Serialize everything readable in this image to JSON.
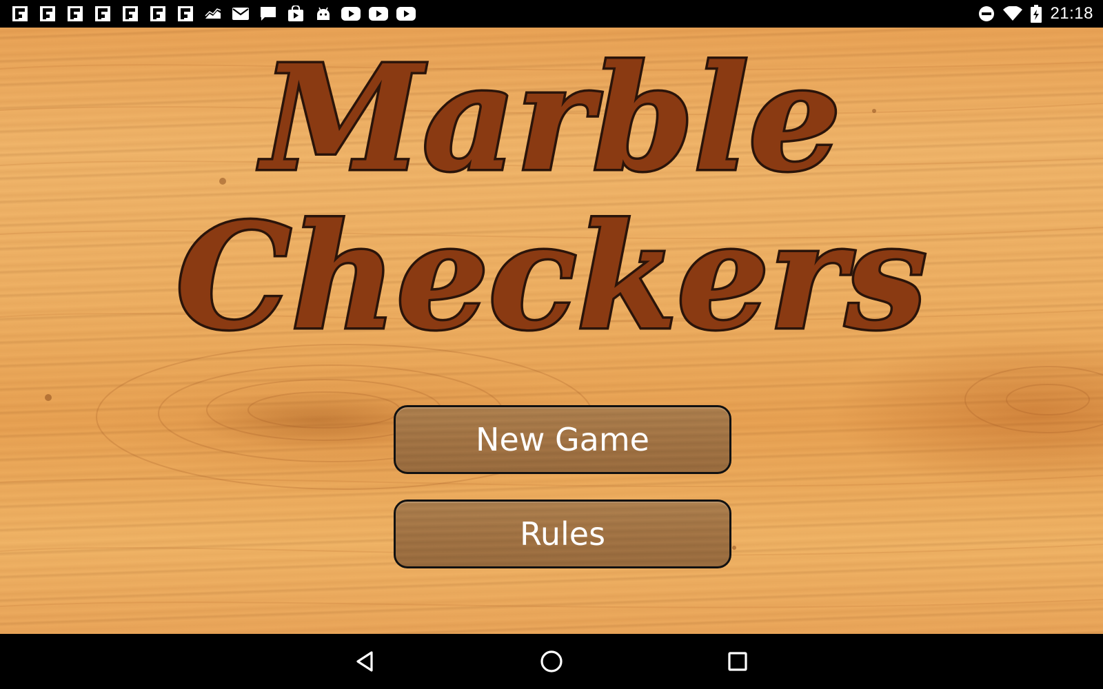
{
  "status_bar": {
    "time": "21:18",
    "notifications": [
      {
        "icon": "flipboard-icon"
      },
      {
        "icon": "flipboard-icon"
      },
      {
        "icon": "flipboard-icon"
      },
      {
        "icon": "flipboard-icon"
      },
      {
        "icon": "flipboard-icon"
      },
      {
        "icon": "flipboard-icon"
      },
      {
        "icon": "flipboard-icon"
      },
      {
        "icon": "chart-icon"
      },
      {
        "icon": "mail-icon"
      },
      {
        "icon": "message-icon"
      },
      {
        "icon": "play-store-icon"
      },
      {
        "icon": "android-icon"
      },
      {
        "icon": "youtube-icon"
      },
      {
        "icon": "youtube-icon"
      },
      {
        "icon": "youtube-icon"
      }
    ],
    "system_icons": [
      "do-not-disturb-icon",
      "wifi-icon",
      "battery-icon"
    ]
  },
  "game": {
    "title_line1": "Marble",
    "title_line2": "Checkers",
    "buttons": {
      "new_game": "New Game",
      "rules": "Rules"
    }
  },
  "colors": {
    "wood": "#eeb063",
    "title_ink": "#2a140a",
    "title_fill": "#8a3a12",
    "button_fill": "#a57646"
  },
  "nav_bar": {
    "buttons": [
      "back-icon",
      "home-icon",
      "recents-icon"
    ]
  }
}
